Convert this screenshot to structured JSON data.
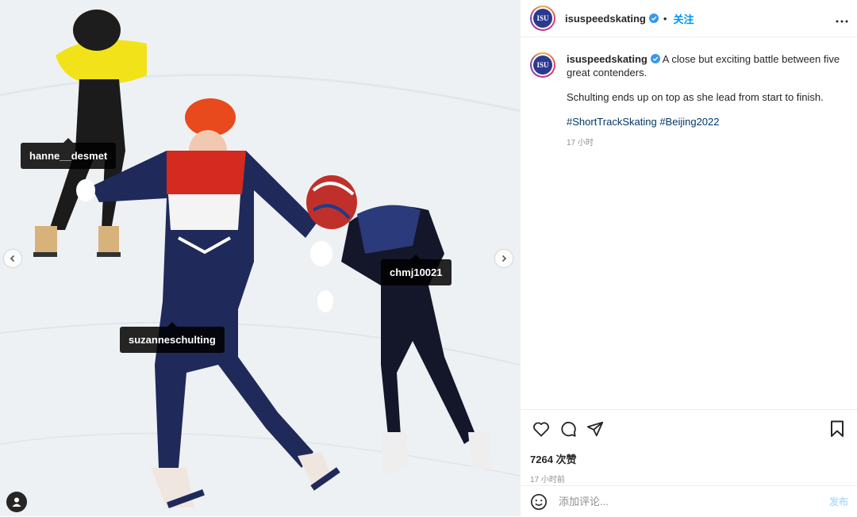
{
  "photo": {
    "tags": [
      {
        "username": "hanne__desmet"
      },
      {
        "username": "chmj10021"
      },
      {
        "username": "suzanneschulting"
      }
    ],
    "nav_prev_icon": "chevron-left-icon",
    "nav_next_icon": "chevron-right-icon",
    "user_tags_icon": "user-icon"
  },
  "header": {
    "username": "isuspeedskating",
    "separator": "•",
    "follow_label": "关注",
    "more_icon": "more-horizontal-icon",
    "avatar_text": "ISU"
  },
  "caption": {
    "username": "isuspeedskating",
    "lines": [
      "A close but exciting battle between five great contenders.",
      "Schulting ends up on top as she lead from start to finish."
    ],
    "hashtags": [
      "#ShortTrackSkating",
      "#Beijing2022"
    ],
    "time": "17 小时"
  },
  "actions": {
    "likes": "7264 次赞",
    "time": "17 小时前"
  },
  "comment": {
    "placeholder": "添加评论...",
    "post_label": "发布"
  },
  "colors": {
    "accent": "#0095f6",
    "hashtag": "#00376b",
    "verified": "#3897f0",
    "post_disabled": "#b2dffc"
  }
}
